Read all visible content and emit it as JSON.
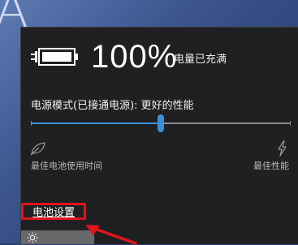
{
  "battery": {
    "percent_text": "100%",
    "status": "电量已充满"
  },
  "power_mode": {
    "label": "电源模式(已接通电源): 更好的性能",
    "slider_value_fraction": 0.5,
    "min_label": "最佳电池使用时间",
    "max_label": "最佳性能"
  },
  "links": {
    "battery_settings": "电池设置"
  },
  "desktop": {
    "corner_glyph": "A"
  },
  "colors": {
    "accent": "#3b8fd8",
    "flyout_bg": "#1f2021",
    "highlight_box": "#e2141d",
    "tile_bg": "#686868"
  },
  "icons": [
    "battery-full-icon",
    "leaf-icon",
    "lightning-bolt-icon",
    "brightness-sun-icon",
    "red-arrow-annotation"
  ]
}
